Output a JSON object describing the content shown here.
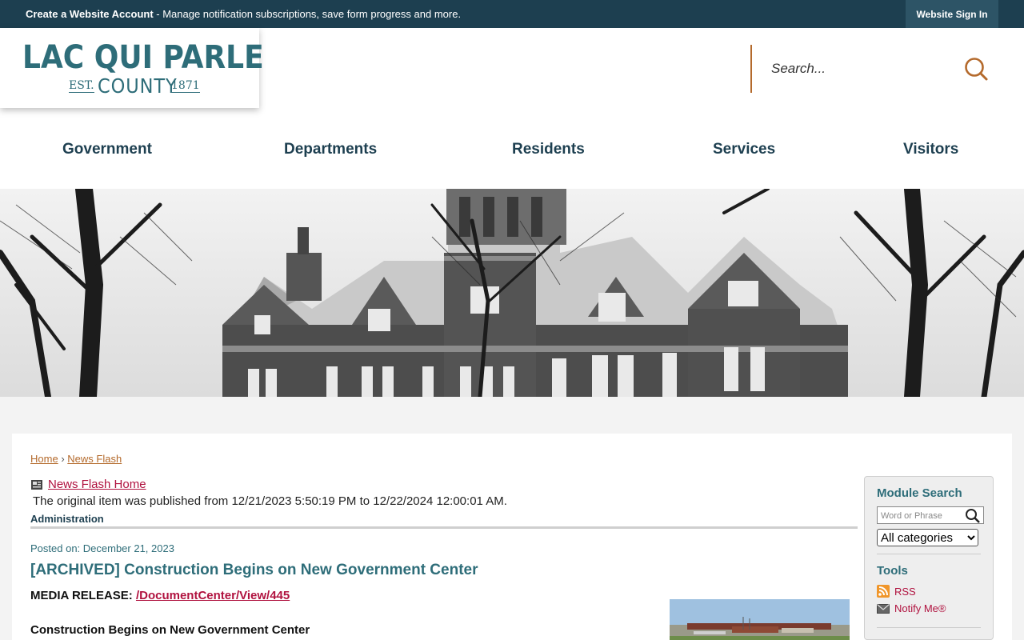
{
  "topbar": {
    "create_label": "Create a Website Account",
    "create_desc": " - Manage notification subscriptions, save form progress and more.",
    "signin_label": "Website Sign In"
  },
  "logo": {
    "line1": "LAC QUI PARLE",
    "est": "EST.",
    "county": "COUNTY",
    "year": "1871"
  },
  "search": {
    "placeholder": "Search..."
  },
  "nav": [
    "Government",
    "Departments",
    "Residents",
    "Services",
    "Visitors"
  ],
  "breadcrumb": {
    "home": "Home",
    "separator": "›",
    "current": "News Flash"
  },
  "article": {
    "news_flash_home": "News Flash Home",
    "original_note": "The original item was published from 12/21/2023 5:50:19 PM to 12/22/2024 12:00:01 AM.",
    "category": "Administration",
    "posted": "Posted on: December 21, 2023",
    "title": "[ARCHIVED] Construction Begins on New Government Center",
    "media_label": "MEDIA RELEASE: ",
    "media_link": "/DocumentCenter/View/445",
    "subheading": "Construction Begins on New Government Center"
  },
  "sidebar": {
    "module_search_title": "Module Search",
    "word_placeholder": "Word or Phrase",
    "category_selected": "All categories",
    "tools_title": "Tools",
    "rss_label": "RSS",
    "notify_label": "Notify Me®"
  },
  "colors": {
    "topbar": "#1d3f50",
    "brand_teal": "#2e6d79",
    "accent_orange": "#b46a2c",
    "link_red": "#b0123f"
  }
}
